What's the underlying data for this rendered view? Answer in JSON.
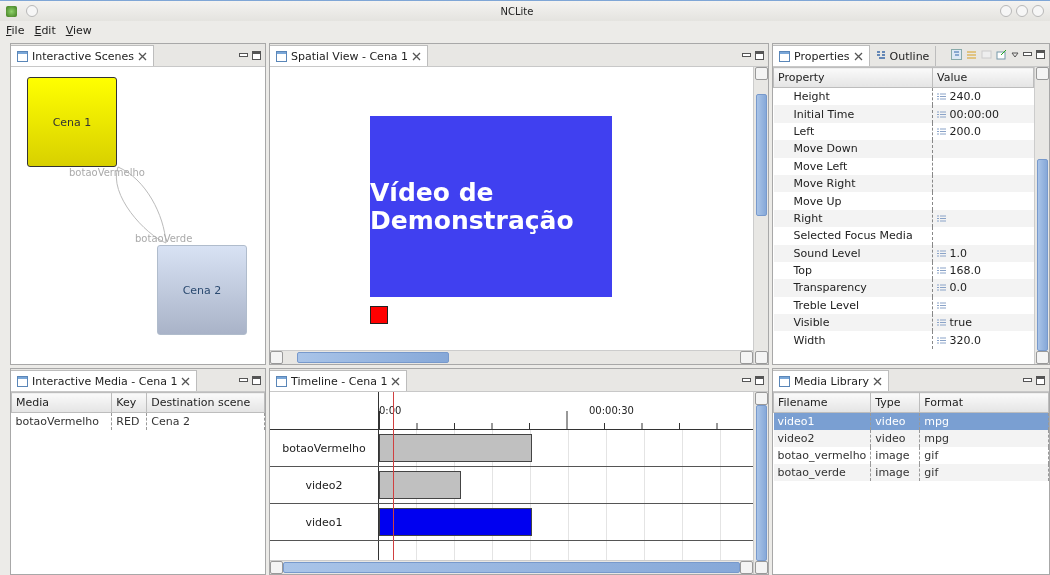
{
  "window": {
    "title": "NCLite"
  },
  "menu": [
    "File",
    "Edit",
    "View"
  ],
  "scenes_panel": {
    "title": "Interactive Scenes",
    "nodes": [
      {
        "label": "Cena 1",
        "selected": true
      },
      {
        "label": "Cena 2",
        "selected": false
      }
    ],
    "edges": [
      "botaoVermelho",
      "botaoVerde"
    ]
  },
  "spatial_panel": {
    "title": "Spatial View - Cena 1",
    "media_text": "Vídeo de Demonstração"
  },
  "properties_panel": {
    "tabs": [
      {
        "label": "Properties",
        "selected": true
      },
      {
        "label": "Outline",
        "selected": false
      }
    ],
    "columns": [
      "Property",
      "Value"
    ],
    "rows": [
      {
        "name": "Height",
        "value": "240.0",
        "editable": true
      },
      {
        "name": "Initial Time",
        "value": "00:00:00",
        "editable": true
      },
      {
        "name": "Left",
        "value": "200.0",
        "editable": true
      },
      {
        "name": "Move Down",
        "editable": false
      },
      {
        "name": "Move Left",
        "editable": false
      },
      {
        "name": "Move Right",
        "editable": false
      },
      {
        "name": "Move Up",
        "editable": false
      },
      {
        "name": "Right",
        "editable": true
      },
      {
        "name": "Selected Focus Media",
        "editable": false
      },
      {
        "name": "Sound Level",
        "value": "1.0",
        "editable": true
      },
      {
        "name": "Top",
        "value": "168.0",
        "editable": true
      },
      {
        "name": "Transparency",
        "value": "0.0",
        "editable": true
      },
      {
        "name": "Treble Level",
        "editable": true
      },
      {
        "name": "Visible",
        "value": "true",
        "editable": true
      },
      {
        "name": "Width",
        "value": "320.0",
        "editable": true
      }
    ]
  },
  "interactive_media_panel": {
    "title": "Interactive Media - Cena 1",
    "columns": [
      "Media",
      "Key",
      "Destination scene"
    ],
    "rows": [
      [
        "botaoVermelho",
        "RED",
        "Cena 2"
      ]
    ]
  },
  "timeline_panel": {
    "title": "Timeline - Cena 1",
    "ticks": [
      "0:00",
      "00:00:30"
    ],
    "tracks": [
      {
        "label": "botaoVermelho",
        "level": 0.41,
        "selected": false
      },
      {
        "label": "video2",
        "level": 0.22,
        "selected": false
      },
      {
        "label": "video1",
        "level": 0.41,
        "selected": true
      }
    ]
  },
  "media_library_panel": {
    "title": "Media Library",
    "columns": [
      "Filename",
      "Type",
      "Format"
    ],
    "rows": [
      {
        "cells": [
          "video1",
          "video",
          "mpg"
        ],
        "selected": true
      },
      {
        "cells": [
          "video2",
          "video",
          "mpg"
        ],
        "selected": false
      },
      {
        "cells": [
          "botao_vermelho",
          "image",
          "gif"
        ],
        "selected": false
      },
      {
        "cells": [
          "botao_verde",
          "image",
          "gif"
        ],
        "selected": false
      }
    ]
  }
}
